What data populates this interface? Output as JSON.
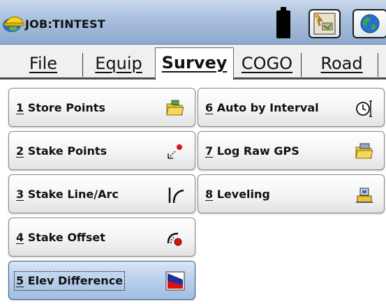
{
  "titlebar": {
    "job_title": "JOB:TINTEST",
    "battery_icon": "battery-icon",
    "status_icon": "instrument-status-icon",
    "globe_icon": "globe-icon"
  },
  "menu": {
    "tabs": [
      {
        "label": "File",
        "active": false
      },
      {
        "label": "Equip",
        "active": false
      },
      {
        "label": "Survey",
        "active": true
      },
      {
        "label": "COGO",
        "active": false
      },
      {
        "label": "Road",
        "active": false
      }
    ]
  },
  "survey_menu": {
    "items": [
      {
        "num": "1",
        "label": " Store Points",
        "icon": "store-points-folder-icon"
      },
      {
        "num": "2",
        "label": " Stake Points",
        "icon": "stake-points-icon"
      },
      {
        "num": "3",
        "label": " Stake Line/Arc",
        "icon": "stake-line-arc-icon"
      },
      {
        "num": "4",
        "label": " Stake Offset",
        "icon": "stake-offset-icon"
      },
      {
        "num": "5",
        "label": " Elev Difference",
        "icon": "elev-difference-icon",
        "selected": true
      },
      {
        "num": "6",
        "label": " Auto by Interval",
        "icon": "auto-interval-clock-icon"
      },
      {
        "num": "7",
        "label": " Log Raw GPS",
        "icon": "log-raw-gps-icon"
      },
      {
        "num": "8",
        "label": " Leveling",
        "icon": "leveling-icon"
      }
    ]
  },
  "colors": {
    "titlebar": "#a9bfdd",
    "selected_button": "#b6cdea",
    "folder_yellow": "#e8c43a",
    "accent_red": "#e01010",
    "elev_blue": "#1e2f9c"
  }
}
